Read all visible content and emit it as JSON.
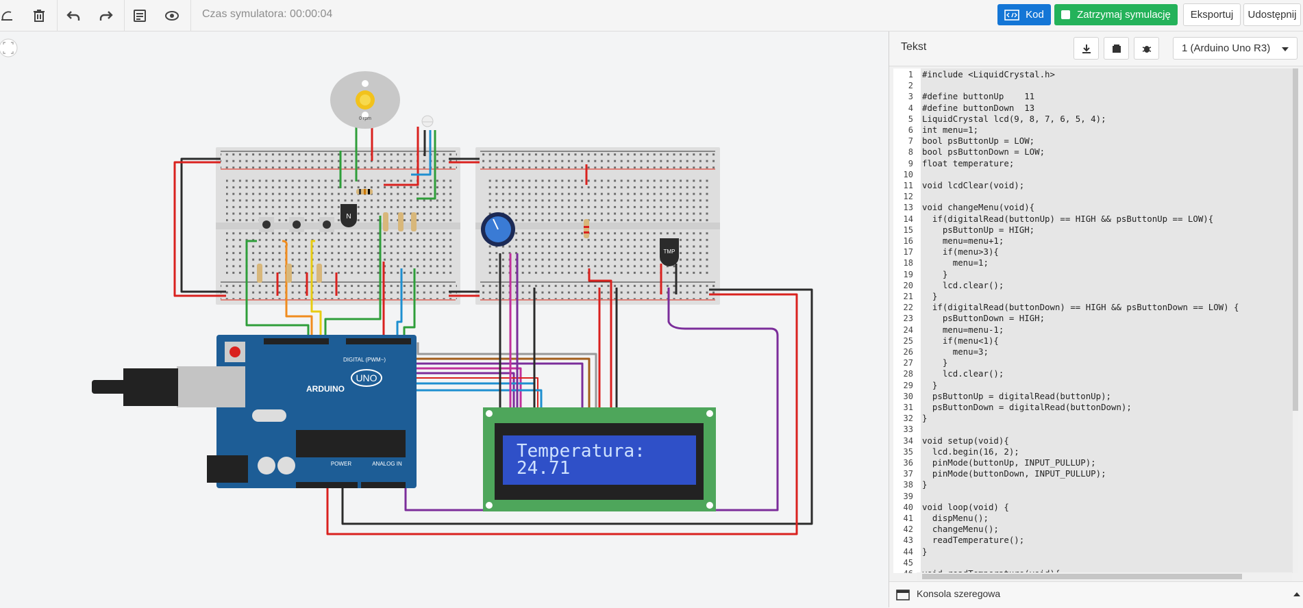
{
  "toolbar": {
    "sim_time": "Czas symulatora: 00:00:04",
    "code_button": "Kod",
    "stop_sim_button": "Zatrzymaj symulację",
    "export_button": "Eksportuj",
    "share_button": "Udostępnij"
  },
  "code_panel": {
    "mode_label": "Tekst",
    "device": "1 (Arduino Uno R3)",
    "console_label": "Konsola szeregowa"
  },
  "lcd": {
    "line1": "Temperatura:",
    "line2": "24.71"
  },
  "components": {
    "motor_label": "0 rpm",
    "transistor_label": "N",
    "tmp_label": "TMP",
    "arduino_model": "UNO",
    "arduino_brand": "ARDUINO",
    "digital_label": "DIGITAL (PWM~)",
    "power_label": "POWER",
    "analog_label": "ANALOG IN"
  },
  "code_lines": [
    "#include <LiquidCrystal.h>",
    "",
    "#define buttonUp    11",
    "#define buttonDown  13",
    "LiquidCrystal lcd(9, 8, 7, 6, 5, 4);",
    "int menu=1;",
    "bool psButtonUp = LOW;",
    "bool psButtonDown = LOW;",
    "float temperature;",
    "",
    "void lcdClear(void);",
    "",
    "void changeMenu(void){",
    "  if(digitalRead(buttonUp) == HIGH && psButtonUp == LOW){",
    "    psButtonUp = HIGH;",
    "    menu=menu+1;",
    "    if(menu>3){",
    "      menu=1;",
    "    }",
    "    lcd.clear();",
    "  }",
    "  if(digitalRead(buttonDown) == HIGH && psButtonDown == LOW) {",
    "    psButtonDown = HIGH;",
    "    menu=menu-1;",
    "    if(menu<1){",
    "      menu=3;",
    "    }",
    "    lcd.clear();",
    "  }",
    "  psButtonUp = digitalRead(buttonUp);",
    "  psButtonDown = digitalRead(buttonDown);",
    "}",
    "",
    "void setup(void){",
    "  lcd.begin(16, 2);",
    "  pinMode(buttonUp, INPUT_PULLUP);",
    "  pinMode(buttonDown, INPUT_PULLUP);",
    "}",
    "",
    "void loop(void) {",
    "  dispMenu();",
    "  changeMenu();",
    "  readTemperature();",
    "}",
    "",
    "void readTemperature(void){",
    ""
  ],
  "colors": {
    "accent_blue": "#1476d6",
    "accent_green": "#24b25a",
    "arduino_blue": "#1d5d96",
    "lcd_blue": "#2f50c8",
    "pcb_green": "#4ea65b"
  }
}
